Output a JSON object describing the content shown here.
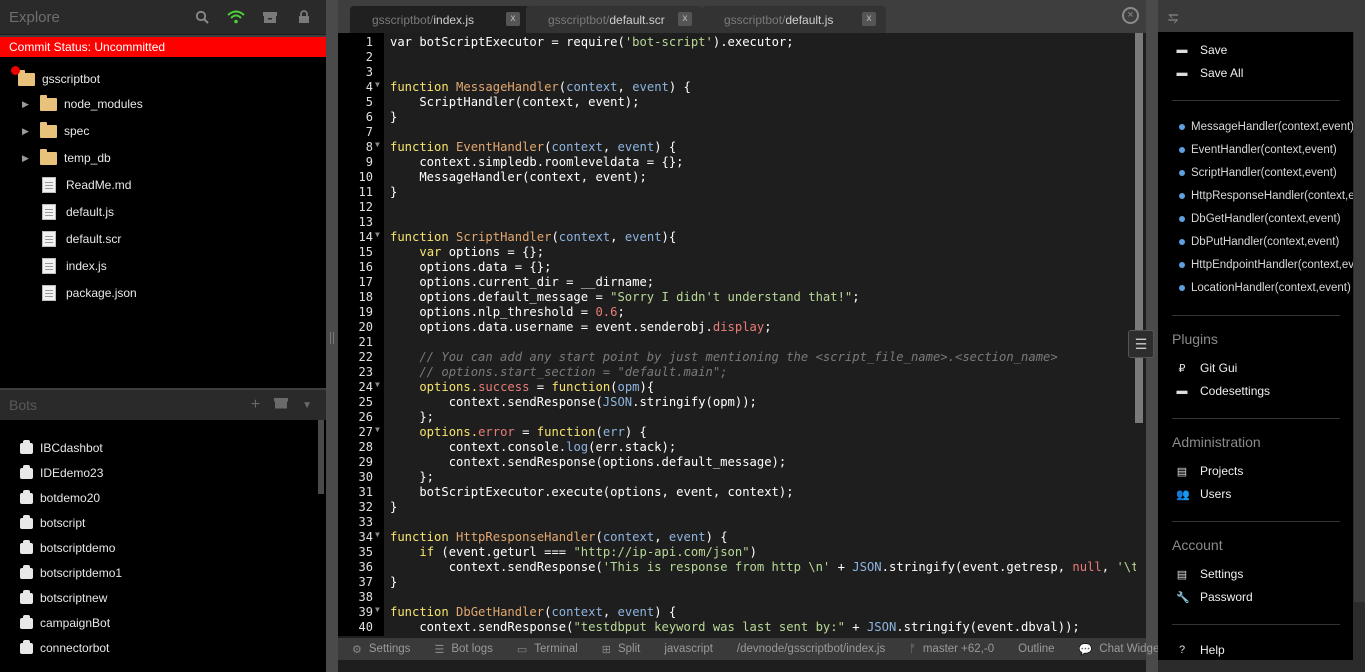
{
  "explorer": {
    "title": "Explore",
    "commit_status": "Commit Status: Uncommitted",
    "root": "gsscriptbot",
    "items": [
      {
        "label": "node_modules",
        "type": "folder"
      },
      {
        "label": "spec",
        "type": "folder"
      },
      {
        "label": "temp_db",
        "type": "folder"
      },
      {
        "label": "ReadMe.md",
        "type": "file"
      },
      {
        "label": "default.js",
        "type": "file"
      },
      {
        "label": "default.scr",
        "type": "file"
      },
      {
        "label": "index.js",
        "type": "file"
      },
      {
        "label": "package.json",
        "type": "file"
      }
    ],
    "icons": [
      "search-icon",
      "wifi-icon",
      "archive-icon",
      "lock-icon"
    ]
  },
  "bots": {
    "title": "Bots",
    "items": [
      "IBCdashbot",
      "IDEdemo23",
      "botdemo20",
      "botscript",
      "botscriptdemo",
      "botscriptdemo1",
      "botscriptnew",
      "campaignBot",
      "connectorbot"
    ]
  },
  "tabs": [
    {
      "prefix": "gsscriptbot/",
      "name": "index.js",
      "active": true,
      "close": "x"
    },
    {
      "prefix": "gsscriptbot/",
      "name": "default.scr",
      "active": false,
      "close": "x"
    },
    {
      "prefix": "gsscriptbot/",
      "name": "default.js",
      "active": false,
      "close": "x"
    }
  ],
  "close_all": "×",
  "code": [
    [
      [
        "var botScriptExecutor = require(",
        ""
      ],
      [
        "'bot-script'",
        "st"
      ],
      [
        ").executor;",
        ""
      ]
    ],
    [],
    [],
    [
      [
        "function ",
        "kw"
      ],
      [
        "MessageHandler",
        "fn"
      ],
      [
        "(",
        ""
      ],
      [
        "context",
        "pm"
      ],
      [
        ", ",
        ""
      ],
      [
        "event",
        "pm"
      ],
      [
        ") {",
        ""
      ]
    ],
    [
      [
        "    ScriptHandler(context, event);",
        ""
      ]
    ],
    [
      [
        "}",
        ""
      ]
    ],
    [],
    [
      [
        "function ",
        "kw"
      ],
      [
        "EventHandler",
        "fn"
      ],
      [
        "(",
        ""
      ],
      [
        "context",
        "pm"
      ],
      [
        ", ",
        ""
      ],
      [
        "event",
        "pm"
      ],
      [
        ") {",
        ""
      ]
    ],
    [
      [
        "    context.simpledb.roomleveldata = {};",
        ""
      ]
    ],
    [
      [
        "    MessageHandler(context, event);",
        ""
      ]
    ],
    [
      [
        "}",
        ""
      ]
    ],
    [],
    [],
    [
      [
        "function ",
        "kw"
      ],
      [
        "ScriptHandler",
        "fn"
      ],
      [
        "(",
        ""
      ],
      [
        "context",
        "pm"
      ],
      [
        ", ",
        ""
      ],
      [
        "event",
        "pm"
      ],
      [
        "){",
        ""
      ]
    ],
    [
      [
        "    ",
        ""
      ],
      [
        "var",
        "kw"
      ],
      [
        " options = {};",
        ""
      ]
    ],
    [
      [
        "    options.data = {};",
        ""
      ]
    ],
    [
      [
        "    options.current_dir = __dirname;",
        ""
      ]
    ],
    [
      [
        "    options.default_message = ",
        ""
      ],
      [
        "\"Sorry I didn't understand that!\"",
        "st"
      ],
      [
        ";",
        ""
      ]
    ],
    [
      [
        "    options.nlp_threshold = ",
        ""
      ],
      [
        "0.6",
        "nm2"
      ],
      [
        ";",
        ""
      ]
    ],
    [
      [
        "    options.data.username = event.senderobj.",
        ""
      ],
      [
        "display",
        "nm2"
      ],
      [
        ";",
        ""
      ]
    ],
    [],
    [
      [
        "    // You can add any start point by just mentioning the <script_file_name>.<section_name>",
        "cm"
      ]
    ],
    [
      [
        "    // options.start_section = \"default.main\";",
        "cm"
      ]
    ],
    [
      [
        "    options.",
        "kw"
      ],
      [
        "success",
        "nm2"
      ],
      [
        " = ",
        ""
      ],
      [
        "function",
        "kw"
      ],
      [
        "(",
        ""
      ],
      [
        "opm",
        "pm"
      ],
      [
        "){",
        ""
      ]
    ],
    [
      [
        "        context.sendResponse(",
        ""
      ],
      [
        "JSON",
        "pm"
      ],
      [
        ".stringify(opm));",
        ""
      ]
    ],
    [
      [
        "    };",
        ""
      ]
    ],
    [
      [
        "    options.",
        "kw"
      ],
      [
        "error",
        "nm2"
      ],
      [
        " = ",
        ""
      ],
      [
        "function",
        "kw"
      ],
      [
        "(",
        ""
      ],
      [
        "err",
        "pm"
      ],
      [
        ") {",
        ""
      ]
    ],
    [
      [
        "        context.console.",
        ""
      ],
      [
        "log",
        "pm"
      ],
      [
        "(err.stack);",
        ""
      ]
    ],
    [
      [
        "        context.sendResponse(options.default_message);",
        ""
      ]
    ],
    [
      [
        "    };",
        ""
      ]
    ],
    [
      [
        "    botScriptExecutor.execute(options, event, context);",
        ""
      ]
    ],
    [
      [
        "}",
        ""
      ]
    ],
    [],
    [
      [
        "function ",
        "kw"
      ],
      [
        "HttpResponseHandler",
        "fn"
      ],
      [
        "(",
        ""
      ],
      [
        "context",
        "pm"
      ],
      [
        ", ",
        ""
      ],
      [
        "event",
        "pm"
      ],
      [
        ") {",
        ""
      ]
    ],
    [
      [
        "    ",
        ""
      ],
      [
        "if",
        "kw"
      ],
      [
        " (event.geturl === ",
        ""
      ],
      [
        "\"http://ip-api.com/json\"",
        "st"
      ],
      [
        ")",
        ""
      ]
    ],
    [
      [
        "        context.sendResponse(",
        ""
      ],
      [
        "'This is response from http \\n'",
        "st"
      ],
      [
        " + ",
        ""
      ],
      [
        "JSON",
        "pm"
      ],
      [
        ".stringify(event.getresp, ",
        ""
      ],
      [
        "null",
        "nm2"
      ],
      [
        ", ",
        ""
      ],
      [
        "'\\t'",
        "st"
      ],
      [
        ")",
        ""
      ]
    ],
    [
      [
        "}",
        ""
      ]
    ],
    [],
    [
      [
        "function ",
        "kw"
      ],
      [
        "DbGetHandler",
        "fn"
      ],
      [
        "(",
        ""
      ],
      [
        "context",
        "pm"
      ],
      [
        ", ",
        ""
      ],
      [
        "event",
        "pm"
      ],
      [
        ") {",
        ""
      ]
    ],
    [
      [
        "    context.sendResponse(",
        ""
      ],
      [
        "\"testdbput keyword was last sent by:\"",
        "st"
      ],
      [
        " + ",
        ""
      ],
      [
        "JSON",
        "pm"
      ],
      [
        ".stringify(event.dbval));",
        ""
      ]
    ]
  ],
  "fold_lines": [
    4,
    8,
    14,
    24,
    27,
    34,
    39
  ],
  "statusbar": [
    {
      "icon": "⚙",
      "label": "Settings",
      "name": "settings"
    },
    {
      "icon": "☰",
      "label": "Bot logs",
      "name": "bot-logs"
    },
    {
      "icon": "▭",
      "label": "Terminal",
      "name": "terminal"
    },
    {
      "icon": "⊞",
      "label": "Split",
      "name": "split"
    },
    {
      "icon": "",
      "label": "javascript",
      "name": "language"
    },
    {
      "icon": "",
      "label": "/devnode/gsscriptbot/index.js",
      "name": "file-path"
    },
    {
      "icon": "ᚠ",
      "label": "master +62,-0",
      "name": "git-branch"
    },
    {
      "icon": "",
      "label": "Outline",
      "name": "outline"
    },
    {
      "icon": "💬",
      "label": "Chat Widge",
      "name": "chat-widget"
    }
  ],
  "right": {
    "actions": [
      {
        "icon": "▬",
        "label": "Save"
      },
      {
        "icon": "▬",
        "label": "Save All"
      }
    ],
    "outline": [
      "MessageHandler(context,event)",
      "EventHandler(context,event)",
      "ScriptHandler(context,event)",
      "HttpResponseHandler(context,event)",
      "DbGetHandler(context,event)",
      "DbPutHandler(context,event)",
      "HttpEndpointHandler(context,event)",
      "LocationHandler(context,event)"
    ],
    "plugins_title": "Plugins",
    "plugins": [
      {
        "icon": "₽",
        "label": "Git Gui"
      },
      {
        "icon": "▬",
        "label": "Codesettings"
      }
    ],
    "admin_title": "Administration",
    "admin": [
      {
        "icon": "▤",
        "label": "Projects"
      },
      {
        "icon": "👥",
        "label": "Users"
      }
    ],
    "account_title": "Account",
    "account": [
      {
        "icon": "▤",
        "label": "Settings"
      },
      {
        "icon": "🔧",
        "label": "Password"
      }
    ],
    "help": "Help"
  },
  "colors": {
    "commit_bg": "#ff0000",
    "wifi": "#4cd137",
    "keyword": "#f8e36c"
  }
}
